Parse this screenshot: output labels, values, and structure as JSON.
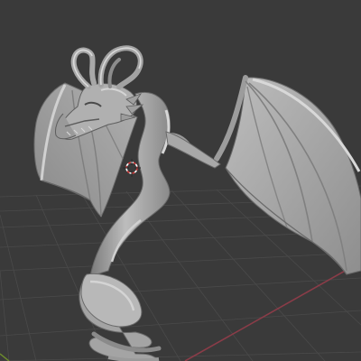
{
  "viewport": {
    "background_color": "#3a3a3a",
    "grid_color": "#4a4a4a",
    "x_axis_color": "#8a3c48",
    "y_axis_color": "#6f8f2c",
    "model": {
      "subject": "dragon",
      "shading": "solid",
      "base_color": "#a6a6a6",
      "highlight_color": "#cfcfcf",
      "shadow_color": "#5c5c5c"
    },
    "cursor_3d": {
      "icon": "3d-cursor-icon",
      "ring_color_a": "#ffffff",
      "ring_color_b": "#d23c3c"
    }
  }
}
